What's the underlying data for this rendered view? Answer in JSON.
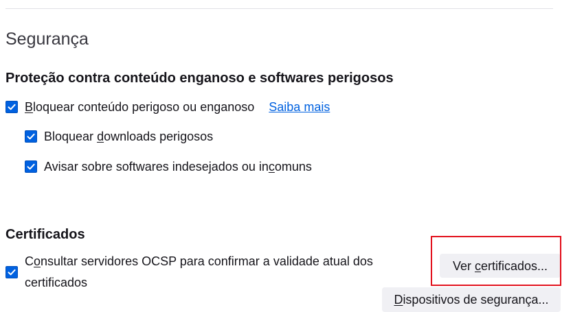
{
  "section": {
    "title": "Segurança"
  },
  "deceptive_content": {
    "heading": "Proteção contra conteúdo enganoso e softwares perigosos",
    "block_dangerous": {
      "label": "Bloquear conteúdo perigoso ou enganoso",
      "accesskey": "B",
      "checked": true
    },
    "learn_more_link": "Saiba mais",
    "block_downloads": {
      "label": "Bloquear downloads perigosos",
      "accesskey": "d",
      "checked": true
    },
    "warn_unwanted": {
      "label": "Avisar sobre softwares indesejados ou incomuns",
      "accesskey": "c",
      "checked": true
    }
  },
  "certificates": {
    "heading": "Certificados",
    "ocsp": {
      "label": "Consultar servidores OCSP para confirmar a validade atual dos certificados",
      "accesskey": "o",
      "checked": true
    },
    "view_certificates_button": {
      "label": "Ver certificados...",
      "accesskey": "c"
    },
    "security_devices_button": {
      "label": "Dispositivos de segurança...",
      "accesskey": "D"
    }
  },
  "icons": {
    "checkbox_mark": "checkmark-icon"
  },
  "colors": {
    "text": "#15141a",
    "link": "#0061e0",
    "checkbox_fill": "#0061e0",
    "checkbox_border": "#0250bb",
    "button_bg": "#f0f0f4",
    "divider": "#e0e0e6",
    "highlight_box": "#e2101c",
    "page_bg": "#ffffff"
  }
}
